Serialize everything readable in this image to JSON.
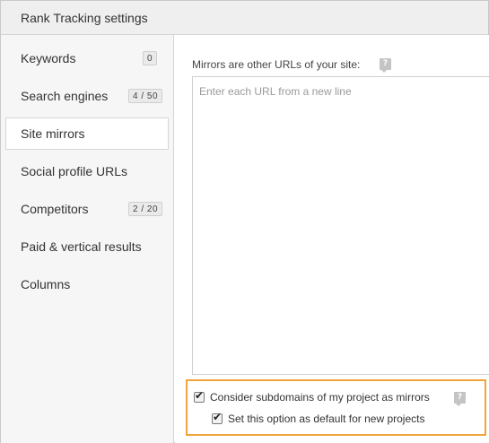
{
  "window": {
    "title": "Rank Tracking settings"
  },
  "sidebar": {
    "items": [
      {
        "label": "Keywords",
        "badge": "0"
      },
      {
        "label": "Search engines",
        "badge": "4 / 50"
      },
      {
        "label": "Site mirrors",
        "badge": ""
      },
      {
        "label": "Social profile URLs",
        "badge": ""
      },
      {
        "label": "Competitors",
        "badge": "2 / 20"
      },
      {
        "label": "Paid & vertical results",
        "badge": ""
      },
      {
        "label": "Columns",
        "badge": ""
      }
    ],
    "active_item": "Site mirrors"
  },
  "main": {
    "mirrors_label": "Mirrors are other URLs of your site:",
    "urls_field": {
      "value": "",
      "placeholder": "Enter each URL from a new line"
    },
    "options": {
      "subdomains": {
        "label": "Consider subdomains of my project as mirrors",
        "checked": true
      },
      "default_for_new": {
        "label": "Set this option as default for new projects",
        "checked": true
      }
    }
  },
  "colors": {
    "highlight_border": "#f0a43a",
    "sidebar_bg": "#f6f6f6",
    "titlebar_bg": "#efefef"
  },
  "icons": {
    "help": "question-mark-help-icon",
    "check": "check-icon"
  }
}
